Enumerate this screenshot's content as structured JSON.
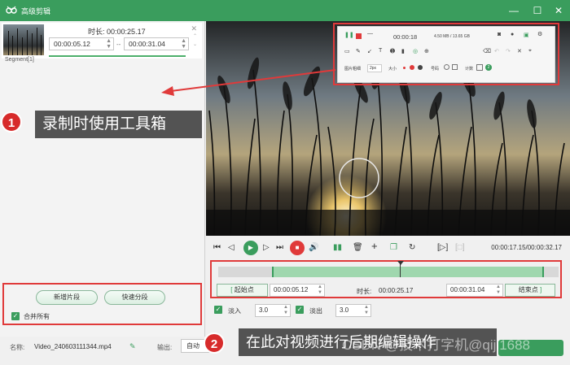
{
  "window": {
    "title": "高级剪辑"
  },
  "segment": {
    "duration_label": "时长:",
    "duration": "00:00:25.17",
    "start_time": "00:00:05.12",
    "separator": "--",
    "end_time": "00:00:31.04",
    "label": "Segment[1]"
  },
  "left_actions": {
    "new_segment": "新增片段",
    "quick_split": "快速分段",
    "merge_all": "合并所有"
  },
  "bottom": {
    "name_label": "名称:",
    "file_name": "Video_240603111344.mp4",
    "output_label": "输出:",
    "output_value": "自动"
  },
  "annotations": {
    "one_number": "1",
    "one_text": "录制时使用工具箱",
    "two_number": "2",
    "two_text": "在此对视频进行后期编辑操作",
    "watermark": "CSDN @技术打字机@qiji1688"
  },
  "recording_toolbar": {
    "time": "00:00:18",
    "stats": "4.50 MB / 13.65 GB",
    "pen_size_label": "图片粗细",
    "pen_size_value": "2px",
    "size_label": "大小",
    "number_label": "号码",
    "counter_label": "计数",
    "counter_value": "2"
  },
  "player": {
    "timecode": "00:00:17.15/00:00:32.17"
  },
  "trim": {
    "start_btn": "起始点",
    "start_time": "00:00:05.12",
    "duration_label": "时长:",
    "duration": "00:00:25.17",
    "end_time": "00:00:31.04",
    "end_btn": "结束点",
    "fade_in_label": "淡入",
    "fade_in_value": "3.0",
    "fade_out_label": "淡出",
    "fade_out_value": "3.0"
  },
  "colors": {
    "brand_green": "#3a9d5d",
    "highlight_red": "#e03a3a",
    "badge_red": "#d72b2b"
  },
  "timeline": {
    "playhead_fraction": 0.533,
    "selection_start_fraction": 0.159,
    "selection_end_fraction": 0.957
  }
}
